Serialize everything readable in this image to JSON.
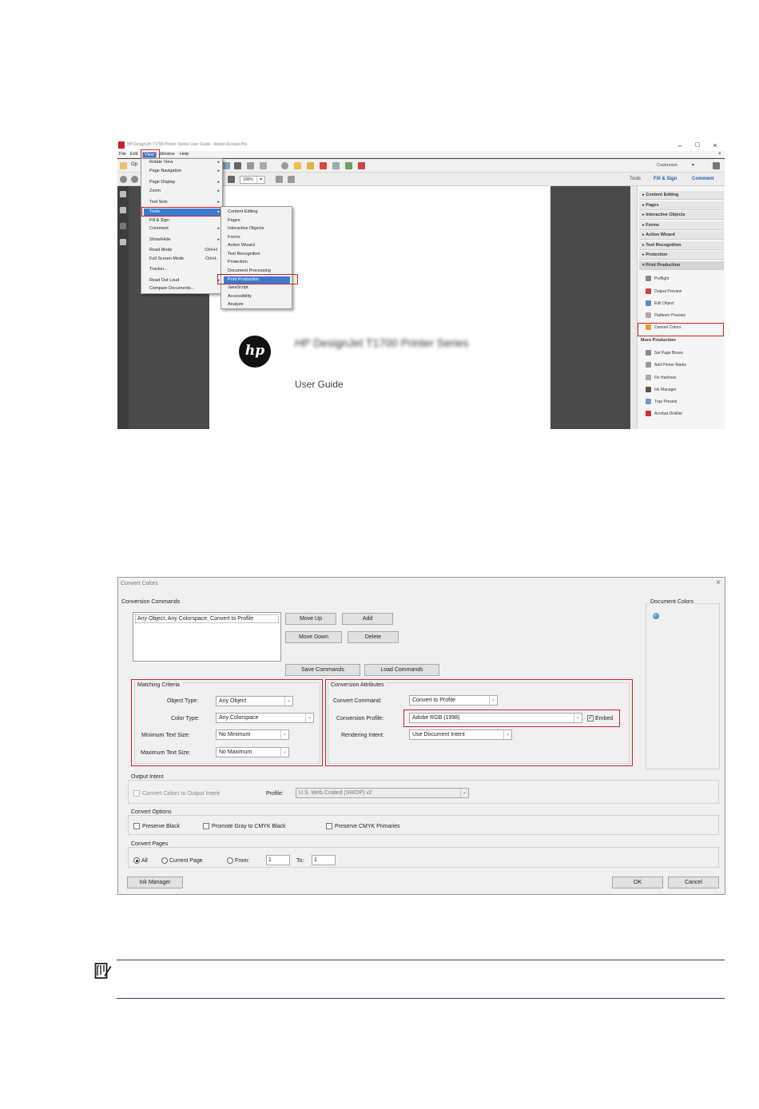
{
  "acrobat": {
    "window_title": "HP DesignJet T1700 Printer Series User Guide - Adobe Acrobat Pro",
    "window_controls": [
      "–",
      "▢",
      "×"
    ],
    "menubar": [
      "File",
      "Edit",
      "View",
      "Window",
      "Help"
    ],
    "toolbar": {
      "open_label": "Op",
      "zoom": "100%",
      "customize": "Customize",
      "tools": "Tools",
      "fill_sign": "Fill & Sign",
      "comment": "Comment"
    },
    "view_menu": [
      {
        "label": "Rotate View",
        "submenu": true
      },
      {
        "label": "Page Navigation",
        "submenu": true
      },
      {
        "label": "Page Display",
        "submenu": true
      },
      {
        "label": "Zoom",
        "submenu": true
      },
      {
        "label": "Tool Sets",
        "submenu": true
      },
      {
        "label": "Tools",
        "submenu": true
      },
      {
        "label": "Fill & Sign",
        "submenu": false
      },
      {
        "label": "Comment",
        "submenu": true
      },
      {
        "label": "Show/Hide",
        "submenu": true
      },
      {
        "label": "Read Mode",
        "shortcut": "Ctrl+H"
      },
      {
        "label": "Full Screen Mode",
        "shortcut": "Ctrl+L"
      },
      {
        "label": "Tracker..."
      },
      {
        "label": "Read Out Loud",
        "submenu": true
      },
      {
        "label": "Compare Documents..."
      }
    ],
    "tools_submenu": [
      "Content Editing",
      "Pages",
      "Interactive Objects",
      "Forms",
      "Action Wizard",
      "Text Recognition",
      "Protection",
      "Document Processing",
      "Print Production",
      "JavaScript",
      "Accessibility",
      "Analyze"
    ],
    "document": {
      "title": "HP DesignJet T1700 Printer Series",
      "subtitle": "User Guide",
      "logo": "hp"
    },
    "right_panel": {
      "sections": [
        "Content Editing",
        "Pages",
        "Interactive Objects",
        "Forms",
        "Action Wizard",
        "Text Recognition",
        "Protection",
        "Print Production"
      ],
      "print_production_items": [
        "Preflight",
        "Output Preview",
        "Edit Object",
        "Flattener Preview",
        "Convert Colors"
      ],
      "more_heading": "More Production",
      "more_items": [
        "Set Page Boxes",
        "Add Printer Marks",
        "Fix Hairlines",
        "Ink Manager",
        "Trap Presets",
        "Acrobat Distiller"
      ]
    }
  },
  "dialog": {
    "title": "Convert Colors",
    "close": "×",
    "conversion_commands": {
      "label": "Conversion Commands",
      "list_item": "Any Object, Any Colorspace, Convert to Profile",
      "move_up": "Move Up",
      "add": "Add",
      "move_down": "Move Down",
      "delete": "Delete",
      "save": "Save Commands",
      "load": "Load Commands"
    },
    "document_colors": "Document Colors",
    "matching": {
      "label": "Matching Criteria",
      "object_type_label": "Object Type:",
      "object_type": "Any Object",
      "color_type_label": "Color Type:",
      "color_type": "Any Colorspace",
      "min_text_label": "Minimum Text Size:",
      "min_text": "No Minimum",
      "max_text_label": "Maximum Text Size:",
      "max_text": "No Maximum"
    },
    "attributes": {
      "label": "Conversion Attributes",
      "command_label": "Convert Command:",
      "command": "Convert to Profile",
      "profile_label": "Conversion Profile:",
      "profile": "Adobe RGB (1998)",
      "embed": "Embed",
      "intent_label": "Rendering Intent:",
      "intent": "Use Document Intent"
    },
    "output_intent": {
      "label": "Output Intent",
      "checkbox": "Convert Colors to Output Intent",
      "profile_label": "Profile:",
      "profile": "U.S. Web Coated (SWOP) v2"
    },
    "convert_options": {
      "label": "Convert Options",
      "preserve_black": "Preserve Black",
      "promote_gray": "Promote Gray to CMYK Black",
      "preserve_cmyk": "Preserve CMYK Primaries"
    },
    "convert_pages": {
      "label": "Convert Pages",
      "all": "All",
      "current": "Current Page",
      "from": "From:",
      "from_value": "1",
      "to": "To:",
      "to_value": "1"
    },
    "ink_manager": "Ink Manager",
    "ok": "OK",
    "cancel": "Cancel"
  },
  "colors": {
    "highlight_red": "#d0202a",
    "menu_select": "#3b7ad0",
    "rule": "#2b3f7a"
  }
}
